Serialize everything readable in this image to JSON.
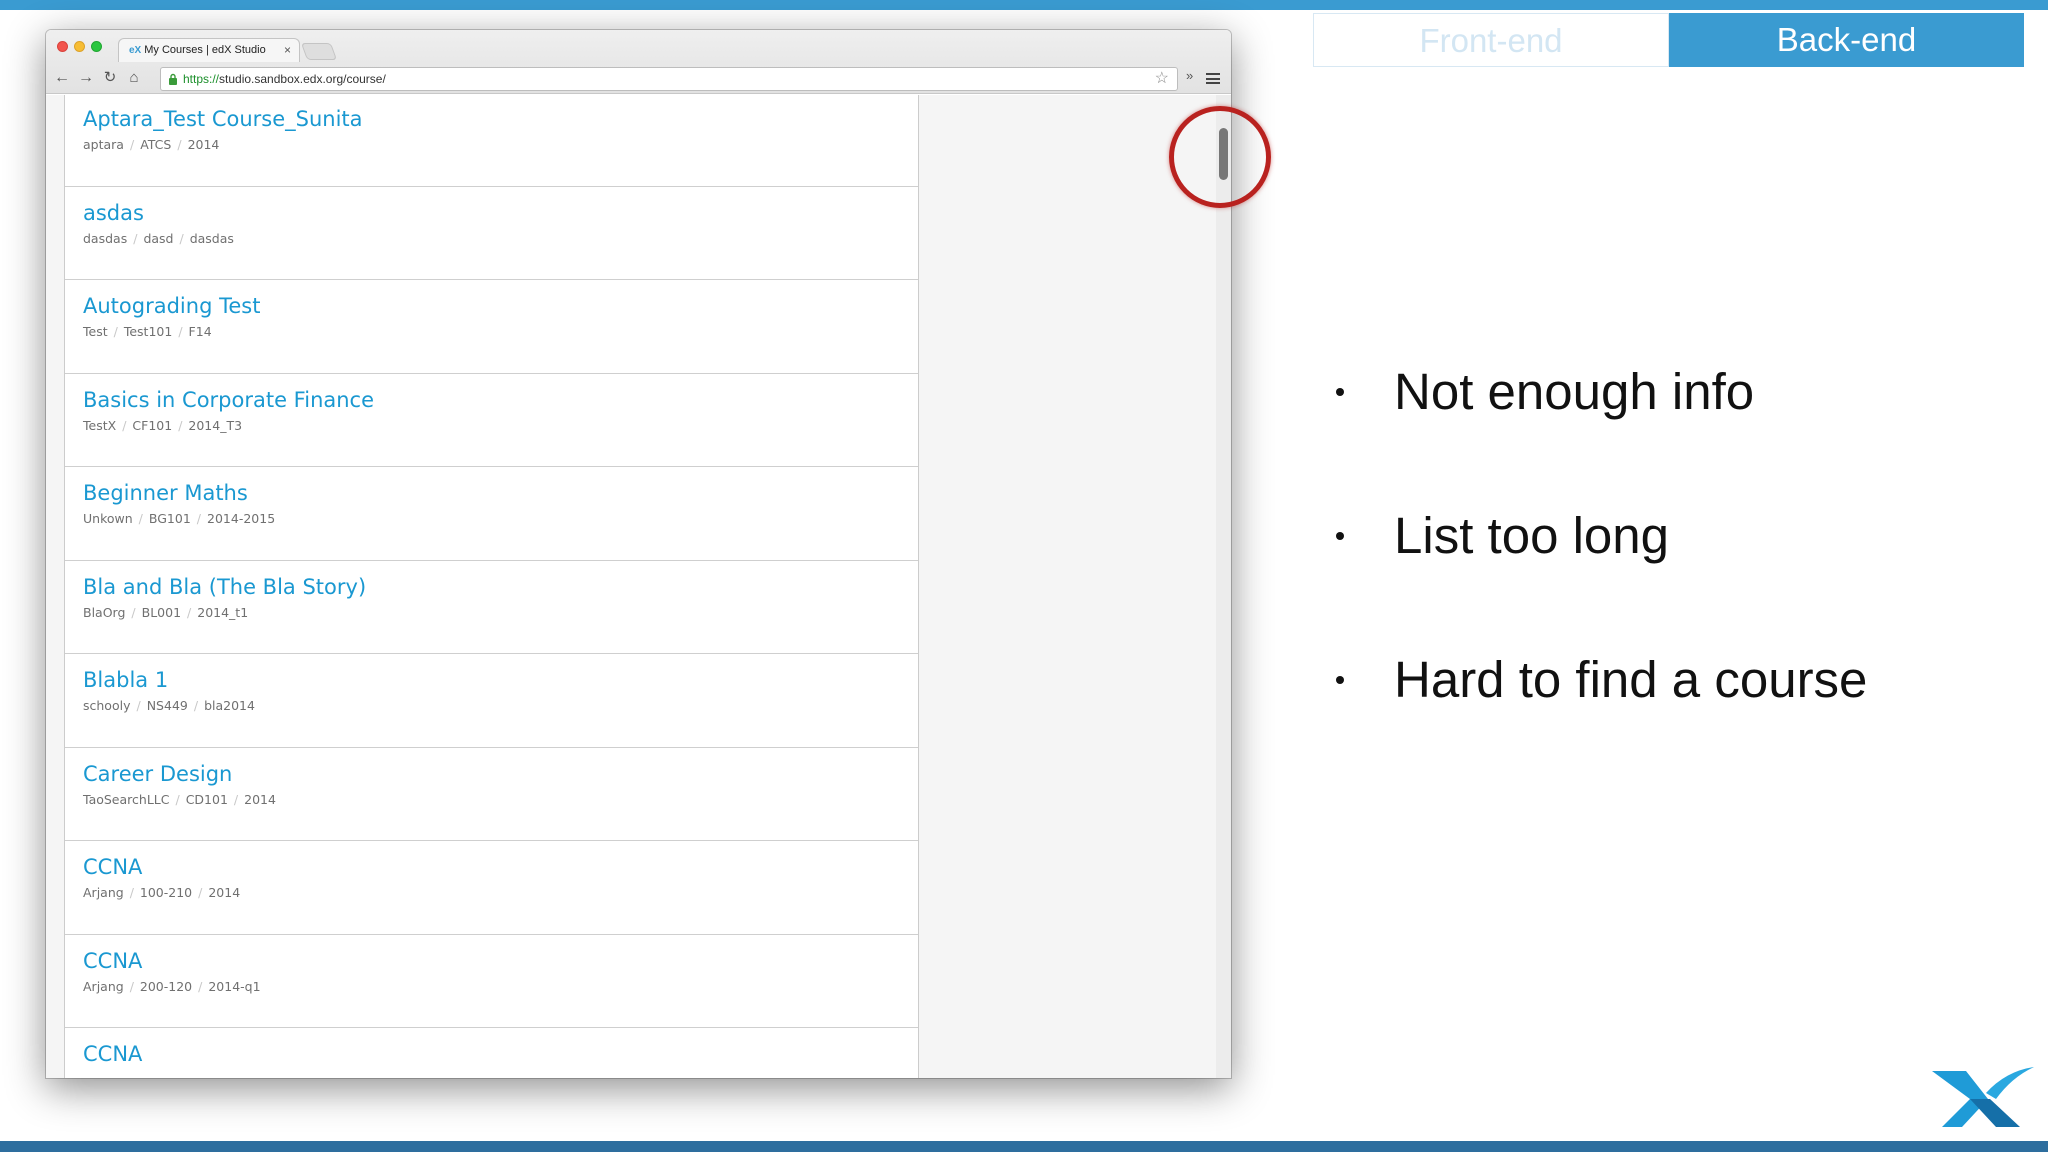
{
  "browser": {
    "tab_title": "My Courses | edX Studio",
    "tab_favicon": "eX",
    "tab_close": "×",
    "url_scheme": "https://",
    "url_rest": "studio.sandbox.edx.org/course/",
    "extensions": "»"
  },
  "courses": [
    {
      "title": "Aptara_Test Course_Sunita",
      "org": "aptara",
      "number": "ATCS",
      "run": "2014"
    },
    {
      "title": "asdas",
      "org": "dasdas",
      "number": "dasd",
      "run": "dasdas"
    },
    {
      "title": "Autograding Test",
      "org": "Test",
      "number": "Test101",
      "run": "F14"
    },
    {
      "title": "Basics in Corporate Finance",
      "org": "TestX",
      "number": "CF101",
      "run": "2014_T3"
    },
    {
      "title": "Beginner Maths",
      "org": "Unkown",
      "number": "BG101",
      "run": "2014-2015"
    },
    {
      "title": "Bla and Bla (The Bla Story)",
      "org": "BlaOrg",
      "number": "BL001",
      "run": "2014_t1"
    },
    {
      "title": "Blabla 1",
      "org": "schooly",
      "number": "NS449",
      "run": "bla2014"
    },
    {
      "title": "Career Design",
      "org": "TaoSearchLLC",
      "number": "CD101",
      "run": "2014"
    },
    {
      "title": "CCNA",
      "org": "Arjang",
      "number": "100-210",
      "run": "2014"
    },
    {
      "title": "CCNA",
      "org": "Arjang",
      "number": "200-120",
      "run": "2014-q1"
    },
    {
      "title": "CCNA",
      "org": "",
      "number": "",
      "run": ""
    }
  ],
  "meta_separator": "/",
  "toggle": {
    "front_label": "Front-end",
    "back_label": "Back-end",
    "active": "Back-end"
  },
  "bullets": [
    "Not enough info",
    "List too long",
    "Hard to find a course"
  ],
  "colors": {
    "accent": "#3a9bd1",
    "link": "#1a98d1",
    "highlight_circle": "#b9221f"
  }
}
